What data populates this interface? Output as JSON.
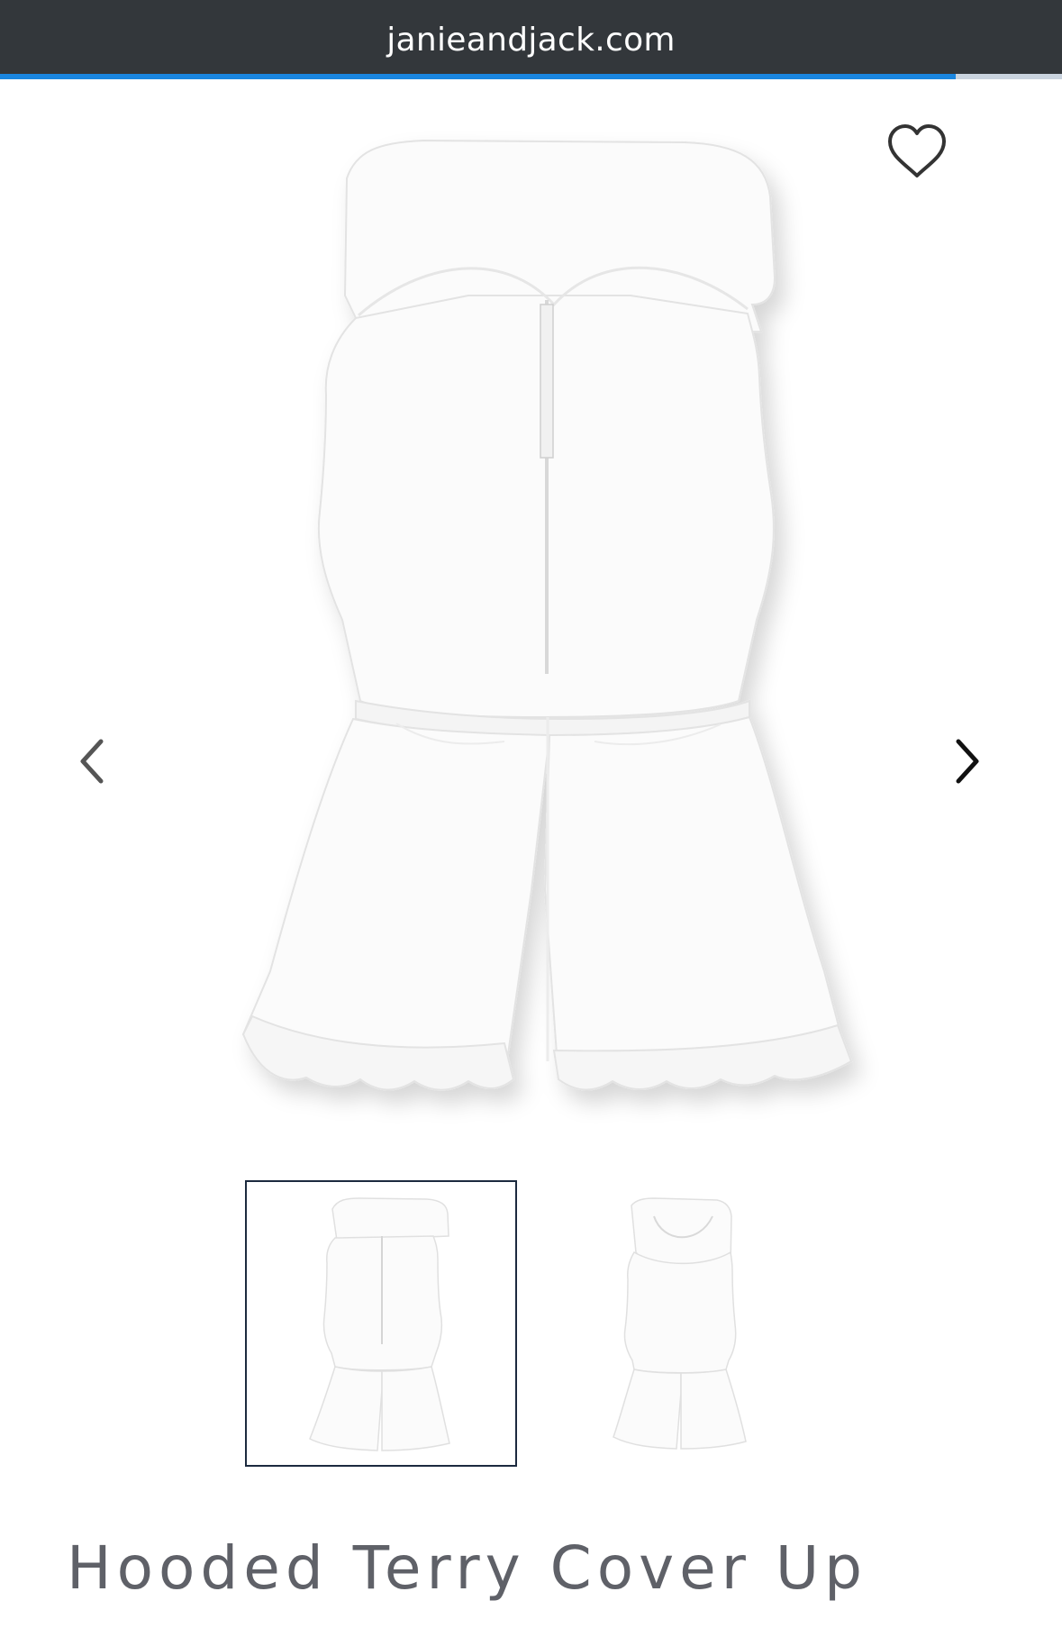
{
  "browser": {
    "url": "janieandjack.com",
    "load_progress": 0.9
  },
  "product": {
    "title": "Hooded Terry Cover Up",
    "main_image_alt": "Hooded Terry Cover Up",
    "thumbnails": [
      {
        "alt": "Hooded Terry Cover Up front",
        "selected": true
      },
      {
        "alt": "Hooded Terry Cover Up back",
        "selected": false
      }
    ]
  },
  "icons": {
    "favorite": "heart-outline-icon",
    "prev": "chevron-left-icon",
    "next": "chevron-right-icon"
  },
  "colors": {
    "url_bar": "#33373b",
    "progress": "#1a86e0",
    "title": "#5f6168",
    "thumb_border": "#1c2a3f"
  }
}
